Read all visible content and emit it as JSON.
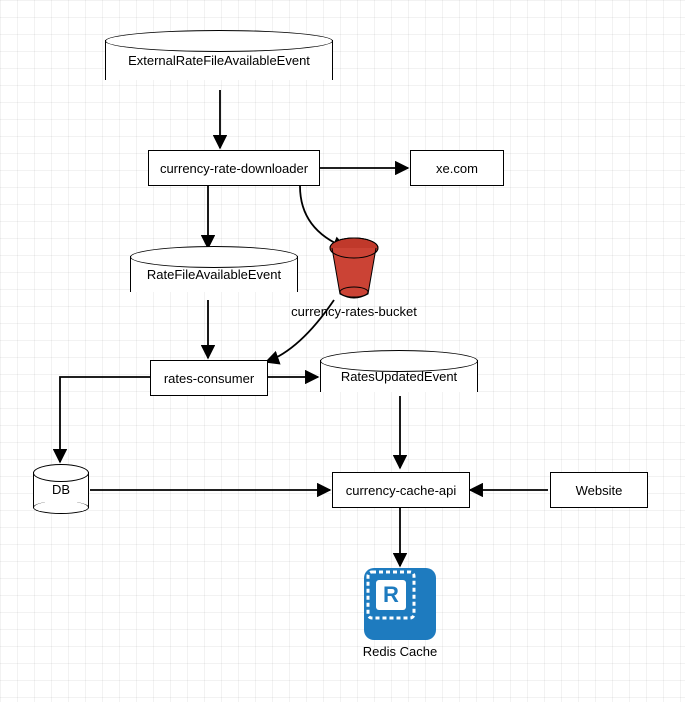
{
  "nodes": {
    "external_event": "ExternalRateFileAvailableEvent",
    "downloader": "currency-rate-downloader",
    "xe": "xe.com",
    "rate_event": "RateFileAvailableEvent",
    "bucket": "currency-rates-bucket",
    "consumer": "rates-consumer",
    "updated_event": "RatesUpdatedEvent",
    "db": "DB",
    "cache_api": "currency-cache-api",
    "website": "Website",
    "redis": "Redis Cache"
  },
  "edges": [
    {
      "from": "external_event",
      "to": "downloader"
    },
    {
      "from": "downloader",
      "to": "xe"
    },
    {
      "from": "downloader",
      "to": "rate_event"
    },
    {
      "from": "downloader",
      "to": "bucket"
    },
    {
      "from": "rate_event",
      "to": "consumer"
    },
    {
      "from": "bucket",
      "to": "consumer"
    },
    {
      "from": "consumer",
      "to": "db"
    },
    {
      "from": "consumer",
      "to": "updated_event"
    },
    {
      "from": "updated_event",
      "to": "cache_api"
    },
    {
      "from": "db",
      "to": "cache_api"
    },
    {
      "from": "website",
      "to": "cache_api"
    },
    {
      "from": "cache_api",
      "to": "redis"
    }
  ]
}
